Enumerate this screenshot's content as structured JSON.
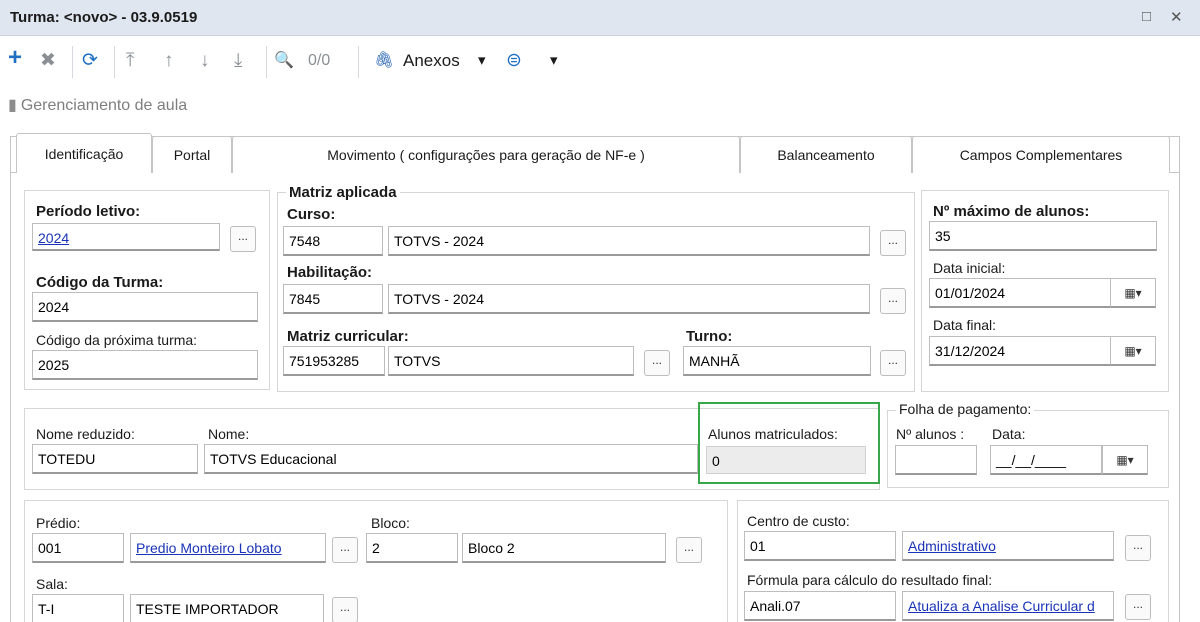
{
  "window": {
    "title": "Turma: <novo> - 03.9.0519",
    "restore_glyph": "□",
    "close_glyph": "✕"
  },
  "toolbar": {
    "add_glyph": "+",
    "delete_glyph": "✖",
    "refresh_glyph": "⟳",
    "first_glyph": "⤒",
    "prev_glyph": "↑",
    "next_glyph": "↓",
    "last_glyph": "⤓",
    "search_glyph": "🔍",
    "counter": "0/0",
    "attach_glyph": "🖇",
    "attachments_label": "Anexos",
    "dropdown_glyph": "▾",
    "circle_glyph": "⊜"
  },
  "breadcrumb": {
    "icon": "▮",
    "label": "Gerenciamento de aula"
  },
  "tabs": [
    "Identificação",
    "Portal",
    "Movimento ( configurações para geração de NF-e )",
    "Balanceamento",
    "Campos Complementares"
  ],
  "periodo": {
    "periodo_label": "Período letivo:",
    "periodo_value": "2024",
    "codigo_label": "Código da Turma:",
    "codigo_value": "2024",
    "proxima_label": "Código da próxima turma:",
    "proxima_value": "2025"
  },
  "matriz": {
    "legend": "Matriz aplicada",
    "curso_label": "Curso:",
    "curso_code": "7548",
    "curso_name": "TOTVS - 2024",
    "habilitacao_label": "Habilitação:",
    "habilitacao_code": "7845",
    "habilitacao_name": "TOTVS - 2024",
    "matriz_label": "Matriz curricular:",
    "matriz_code": "751953285",
    "matriz_name": "TOTVS",
    "turno_label": "Turno:",
    "turno_value": "MANHÃ"
  },
  "alunos": {
    "max_label": "Nº máximo de alunos:",
    "max_value": "35",
    "data_inicial_label": "Data inicial:",
    "data_inicial_value": "01/01/2024",
    "data_final_label": "Data final:",
    "data_final_value": "31/12/2024"
  },
  "nome": {
    "reduzido_label": "Nome reduzido:",
    "reduzido_value": "TOTEDU",
    "nome_label": "Nome:",
    "nome_value": "TOTVS Educacional",
    "matriculados_label": "Alunos matriculados:",
    "matriculados_value": "0"
  },
  "folha": {
    "legend": "Folha de pagamento:",
    "alunos_label": "Nº alunos :",
    "alunos_value": "",
    "data_label": "Data:",
    "data_value": "__/__/____"
  },
  "local": {
    "predio_label": "Prédio:",
    "predio_code": "001",
    "predio_name": "Predio Monteiro Lobato",
    "bloco_label": "Bloco:",
    "bloco_code": "2",
    "bloco_name": "Bloco 2",
    "sala_label": "Sala:",
    "sala_code": "T-I",
    "sala_name": "TESTE IMPORTADOR"
  },
  "custo": {
    "centro_label": "Centro de custo:",
    "centro_code": "01",
    "centro_name": "Administrativo",
    "formula_label": "Fórmula para cálculo do resultado final:",
    "formula_code": "Anali.07",
    "formula_name": "Atualiza a Analise Curricular d"
  },
  "common": {
    "ellipsis": "...",
    "calendar_glyph": "▦▾"
  },
  "colors": {
    "highlight": "#3aa64a",
    "link": "#1a33b8",
    "titlebar": "#dfe6ef"
  }
}
